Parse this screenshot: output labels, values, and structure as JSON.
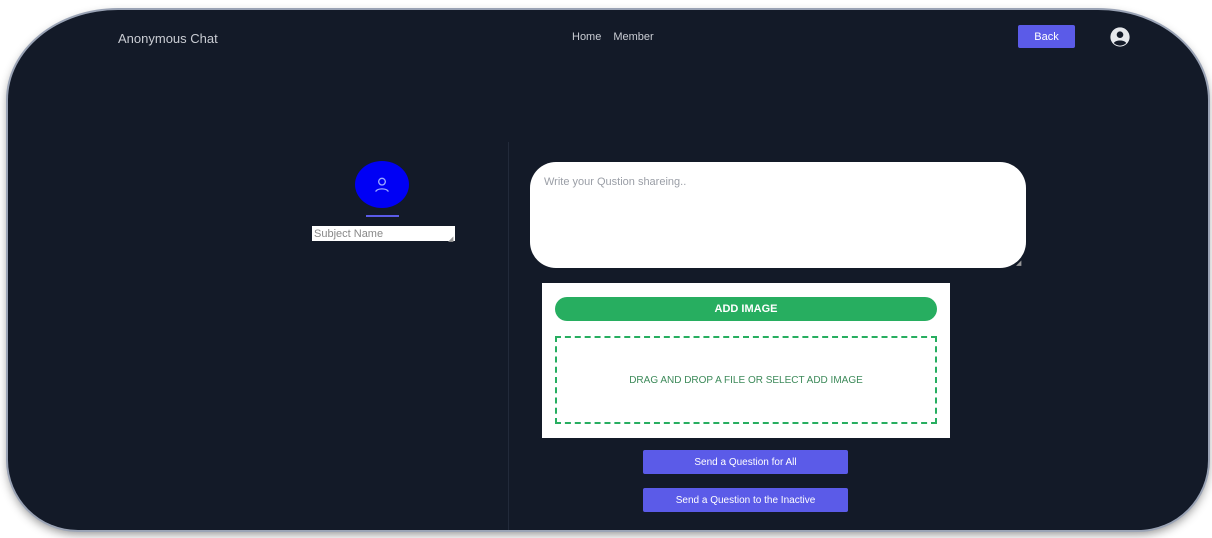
{
  "header": {
    "brand": "Anonymous Chat",
    "nav": [
      "Home",
      "Member"
    ],
    "back_label": "Back",
    "profile_icon": "user-circle-icon"
  },
  "subject": {
    "avatar_icon": "user-icon",
    "placeholder": "Subject Name",
    "value": ""
  },
  "question": {
    "placeholder": "Write your Qustion shareing..",
    "value": ""
  },
  "upload": {
    "add_image_label": "ADD IMAGE",
    "dropzone_text": "DRAG AND DROP A FILE OR SELECT ADD IMAGE"
  },
  "actions": {
    "send_all_label": "Send a Question for All",
    "send_inactive_label": "Send a Question to the Inactive"
  },
  "colors": {
    "background": "#131a28",
    "accent": "#5b5be8",
    "avatar": "#0000f5",
    "success": "#27ae60"
  }
}
